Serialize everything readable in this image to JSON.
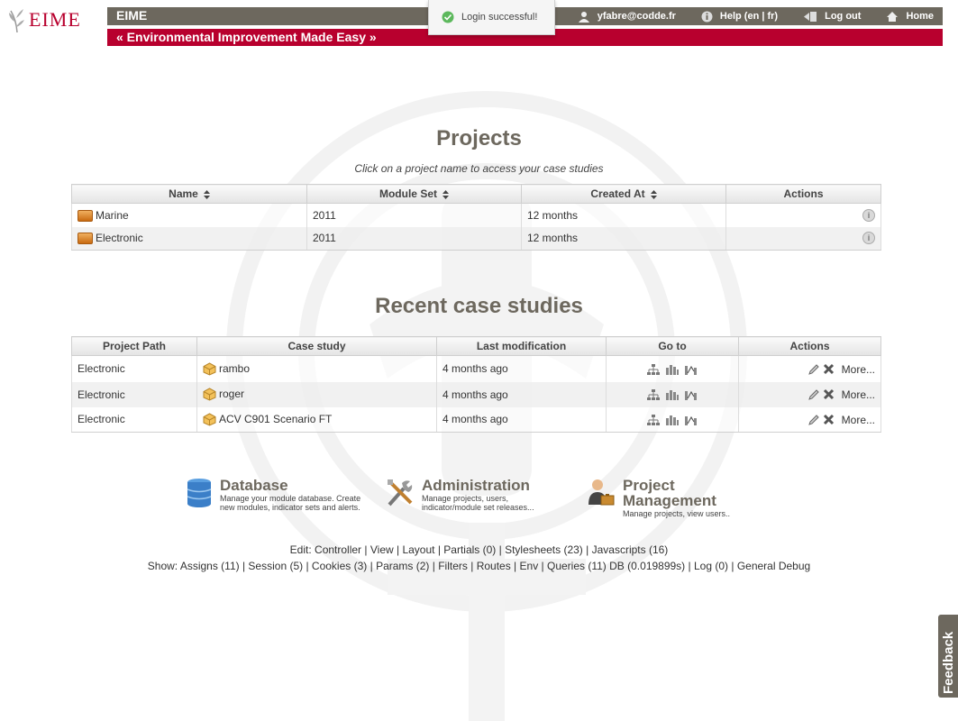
{
  "brand": {
    "logo_text": "EIME",
    "app_title": "EIME",
    "tagline": "« Environmental Improvement Made Easy »"
  },
  "toast": {
    "message": "Login successful!"
  },
  "top_links": [
    {
      "label": "yfabre@codde.fr",
      "icon": "user-icon"
    },
    {
      "label": "Help (en | fr)",
      "icon": "help-icon"
    },
    {
      "label": "Log out",
      "icon": "logout-icon"
    },
    {
      "label": "Home",
      "icon": "home-icon"
    }
  ],
  "projects": {
    "title": "Projects",
    "subtitle": "Click on a project name to access your case studies",
    "columns": [
      "Name",
      "Module Set",
      "Created At",
      "Actions"
    ],
    "rows": [
      {
        "name": "Marine",
        "module_set": "2011",
        "created_at": "12 months"
      },
      {
        "name": "Electronic",
        "module_set": "2011",
        "created_at": "12 months"
      }
    ]
  },
  "recent": {
    "title": "Recent case studies",
    "columns": [
      "Project Path",
      "Case study",
      "Last modification",
      "Go to",
      "Actions"
    ],
    "more_label": "More...",
    "rows": [
      {
        "project_path": "Electronic",
        "case_study": "rambo",
        "last_modification": "4 months ago"
      },
      {
        "project_path": "Electronic",
        "case_study": "roger",
        "last_modification": "4 months ago"
      },
      {
        "project_path": "Electronic",
        "case_study": "ACV C901 Scenario FT",
        "last_modification": "4 months ago"
      }
    ]
  },
  "shortcuts": [
    {
      "title": "Database",
      "desc": "Manage your module database. Create new modules, indicator sets and alerts."
    },
    {
      "title": "Administration",
      "desc": "Manage projects, users, indicator/module set releases..."
    },
    {
      "title": "Project Management",
      "desc": "Manage projects, view users.."
    }
  ],
  "debug": {
    "edit_prefix": "Edit:",
    "edit_links": [
      "Controller",
      "View",
      "Layout",
      "Partials (0)",
      "Stylesheets (23)",
      "Javascripts (16)"
    ],
    "show_prefix": "Show:",
    "show_links": [
      "Assigns (11)",
      "Session (5)",
      "Cookies (3)",
      "Params (2)",
      "Filters",
      "Routes",
      "Env",
      "Queries (11) DB (0.019899s)",
      "Log (0)",
      "General Debug"
    ]
  },
  "feedback_label": "Feedback",
  "colors": {
    "header": "#6d685e",
    "accent": "#b8002e"
  }
}
